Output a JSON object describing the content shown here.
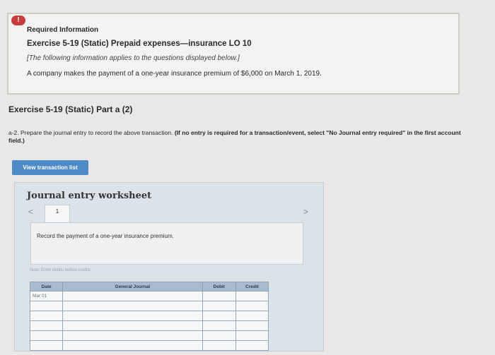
{
  "info": {
    "badge": "!",
    "heading": "Required Information",
    "exercise_title": "Exercise 5-19 (Static) Prepaid expenses—insurance LO 10",
    "note": "[The following information applies to the questions displayed below.]",
    "text": "A company makes the payment of a one-year insurance premium of $6,000 on March 1, 2019."
  },
  "part": {
    "title": "Exercise 5-19 (Static) Part a (2)",
    "instruction_plain": "a-2. Prepare the journal entry to record the above transaction.",
    "instruction_bold": "(If no entry is required for a transaction/event, select \"No Journal entry required\" in the first account field.)"
  },
  "buttons": {
    "view_transaction_list": "View transaction list"
  },
  "worksheet": {
    "title": "Journal entry worksheet",
    "prev": "<",
    "next": ">",
    "tab": "1",
    "instruction": "Record the payment of a one-year insurance premium.",
    "note": "Note: Enter debits before credits.",
    "columns": [
      "Date",
      "General Journal",
      "Debit",
      "Credit"
    ],
    "rows": [
      {
        "date": "Mar 01",
        "account": "",
        "debit": "",
        "credit": ""
      },
      {
        "date": "",
        "account": "",
        "debit": "",
        "credit": ""
      },
      {
        "date": "",
        "account": "",
        "debit": "",
        "credit": ""
      },
      {
        "date": "",
        "account": "",
        "debit": "",
        "credit": ""
      },
      {
        "date": "",
        "account": "",
        "debit": "",
        "credit": ""
      },
      {
        "date": "",
        "account": "",
        "debit": "",
        "credit": ""
      }
    ]
  }
}
